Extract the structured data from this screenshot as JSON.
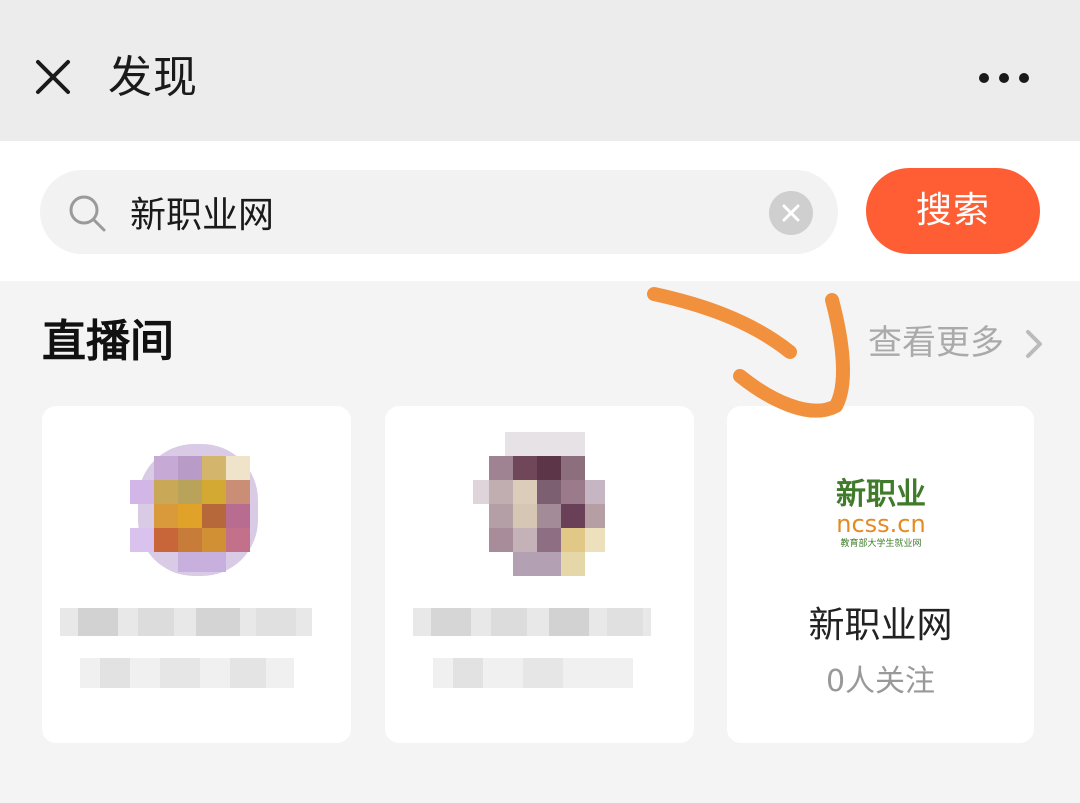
{
  "header": {
    "title": "发现",
    "close_icon": "close-icon",
    "more_icon": "more-icon"
  },
  "search": {
    "value": "新职业网",
    "search_icon": "search-icon",
    "clear_icon": "clear-icon",
    "button_label": "搜索"
  },
  "section": {
    "title": "直播间",
    "view_more_label": "查看更多"
  },
  "results": [
    {
      "name": "",
      "followers": "",
      "blurred": true
    },
    {
      "name": "",
      "followers": "",
      "blurred": true
    },
    {
      "name": "新职业网",
      "followers": "0人关注",
      "logo": {
        "cn_text": "新职业",
        "domain_text": "ncss.cn",
        "tagline": "教育部大学生就业网"
      }
    }
  ],
  "colors": {
    "accent": "#ff5d33",
    "annotation_arrow": "#f2913d",
    "logo_green": "#3f7b2a",
    "logo_orange": "#e58a22"
  }
}
